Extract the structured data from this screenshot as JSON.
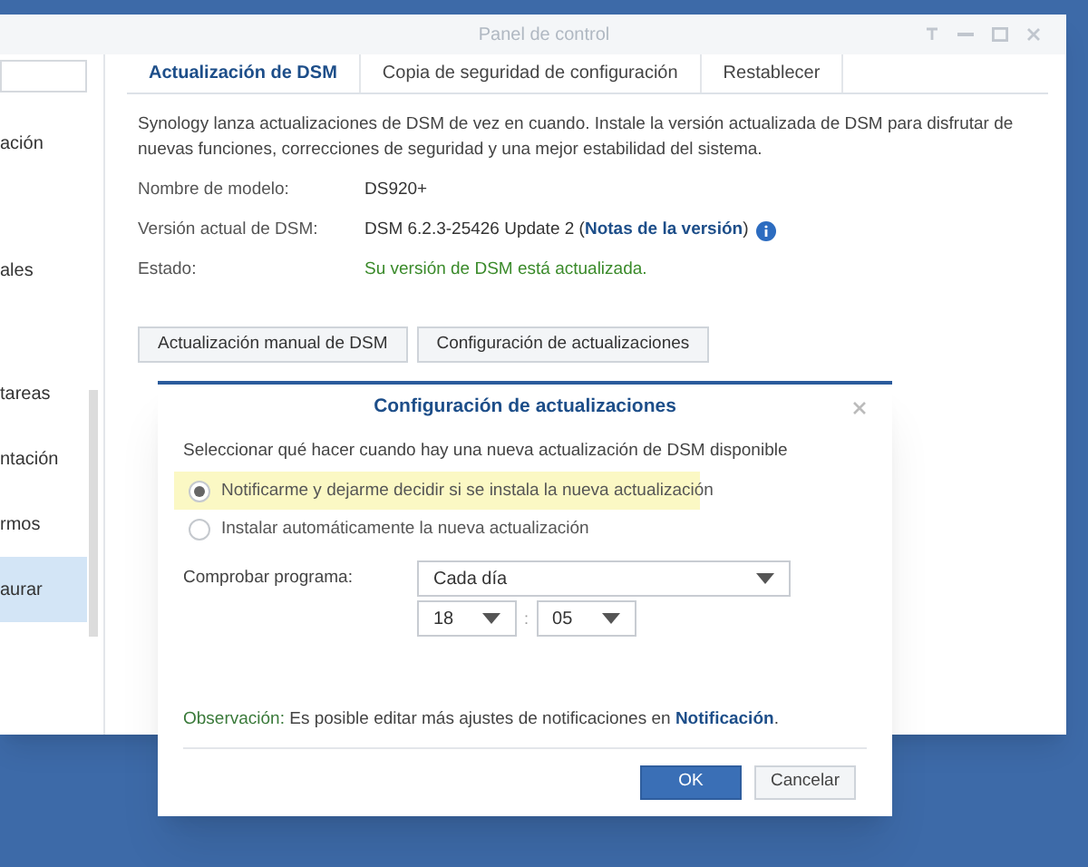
{
  "window": {
    "title": "Panel de control"
  },
  "sidebar": {
    "items": [
      {
        "label": "ación",
        "selected": false
      },
      {
        "label": "ales",
        "selected": false
      },
      {
        "label": "tareas",
        "selected": false
      },
      {
        "label": "ntación",
        "selected": false
      },
      {
        "label": "rmos",
        "selected": false
      },
      {
        "label": "aurar",
        "selected": true
      }
    ]
  },
  "tabs": [
    {
      "label": "Actualización de DSM",
      "selected": true
    },
    {
      "label": "Copia de seguridad de configuración",
      "selected": false
    },
    {
      "label": "Restablecer",
      "selected": false
    }
  ],
  "description": "Synology lanza actualizaciones de DSM de vez en cuando. Instale la versión actualizada de DSM para disfrutar de nuevas funciones, correcciones de seguridad y una mejor estabilidad del sistema.",
  "info": [
    {
      "kind": "plain",
      "label": "Nombre de modelo:",
      "value": "DS920+"
    },
    {
      "kind": "with_link",
      "label": "Versión actual de DSM:",
      "value": "DSM 6.2.3-25426 Update 2 (",
      "link": "Notas de la versión",
      "suffix": ")"
    },
    {
      "kind": "status",
      "label": "Estado:",
      "value": "Su versión de DSM está actualizada."
    }
  ],
  "buttons": [
    "Actualización manual de DSM",
    "Configuración de actualizaciones"
  ],
  "dialog": {
    "title": "Configuración de actualizaciones",
    "prompt": "Seleccionar qué hacer cuando hay una nueva actualización de DSM disponible",
    "options": [
      {
        "label": "Notificarme y dejarme decidir si se instala la nueva actualización",
        "selected": true,
        "highlighted": true
      },
      {
        "label": "Instalar automáticamente la nueva actualización",
        "selected": false,
        "highlighted": false
      }
    ],
    "schedule": {
      "label": "Comprobar programa:",
      "frequency": "Cada día",
      "hour": "18",
      "separator": ":",
      "minute": "05"
    },
    "note": {
      "label": "Observación:",
      "text": " Es posible editar más ajustes de notificaciones en ",
      "link": "Notificación",
      "end": "."
    },
    "buttons": [
      {
        "label": "OK",
        "kind": "primary"
      },
      {
        "label": "Cancelar",
        "kind": "secondary"
      }
    ]
  }
}
